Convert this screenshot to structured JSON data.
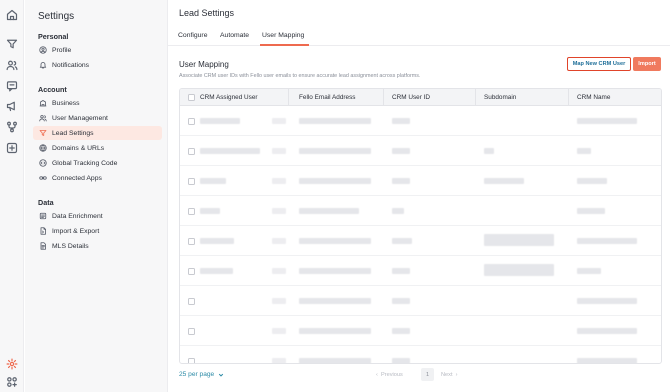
{
  "rail": {
    "icons": [
      "home-icon",
      "funnel-icon",
      "users-icon",
      "chat-icon",
      "megaphone-icon",
      "workflow-icon",
      "plus-box-icon",
      "gear-icon",
      "apps-icon"
    ]
  },
  "sidebar": {
    "title": "Settings",
    "sections": [
      {
        "title": "Personal",
        "items": [
          {
            "label": "Profile",
            "icon": "user-circle-icon"
          },
          {
            "label": "Notifications",
            "icon": "bell-icon"
          }
        ]
      },
      {
        "title": "Account",
        "items": [
          {
            "label": "Business",
            "icon": "building-icon"
          },
          {
            "label": "User Management",
            "icon": "users-icon"
          },
          {
            "label": "Lead Settings",
            "icon": "funnel-icon",
            "active": true
          },
          {
            "label": "Domains & URLs",
            "icon": "globe-icon"
          },
          {
            "label": "Global Tracking Code",
            "icon": "code-icon"
          },
          {
            "label": "Connected Apps",
            "icon": "link-icon"
          }
        ]
      },
      {
        "title": "Data",
        "items": [
          {
            "label": "Data Enrichment",
            "icon": "database-icon"
          },
          {
            "label": "Import & Export",
            "icon": "file-icon"
          },
          {
            "label": "MLS Details",
            "icon": "document-icon"
          }
        ]
      }
    ]
  },
  "main": {
    "page_title": "Lead Settings",
    "tabs": [
      {
        "label": "Configure"
      },
      {
        "label": "Automate"
      },
      {
        "label": "User Mapping",
        "active": true
      }
    ],
    "section_title": "User Mapping",
    "section_description": "Associate CRM user IDs with Fello user emails to ensure accurate lead assignment across platforms.",
    "map_button": "Map New CRM User",
    "import_button": "Import",
    "table": {
      "columns": [
        "CRM Assigned User",
        "Fello Email Address",
        "CRM User ID",
        "Subdomain",
        "CRM Name"
      ]
    },
    "pagination": {
      "per_page": "25 per page",
      "prev": "Previous",
      "page": "1",
      "next": "Next"
    }
  },
  "colors": {
    "accent": "#ee6a4f",
    "active_bg": "#fde8e2",
    "link": "#2b8aa6",
    "map_button_border": "#e0442a"
  }
}
